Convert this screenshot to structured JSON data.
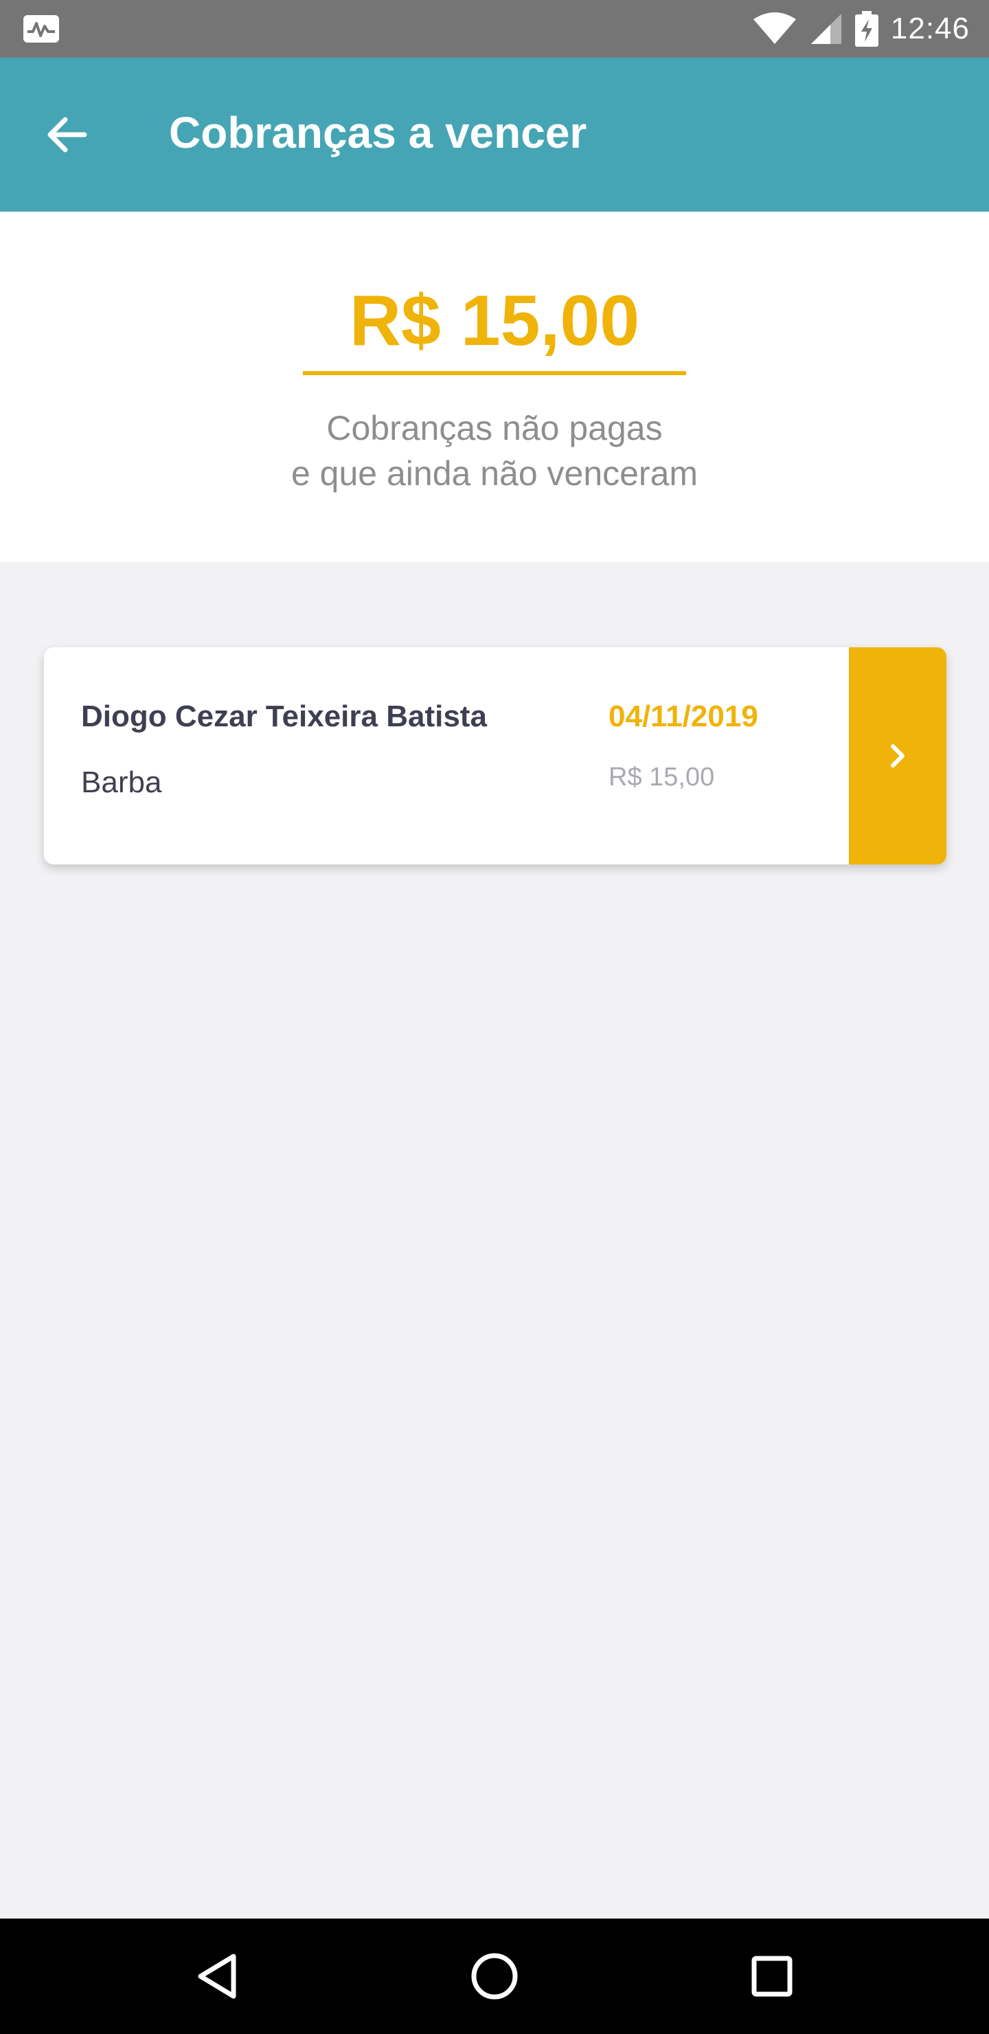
{
  "status_bar": {
    "time": "12:46",
    "icons": [
      "activity-icon",
      "wifi-icon",
      "signal-icon",
      "battery-charging-icon"
    ]
  },
  "app_bar": {
    "title": "Cobranças a vencer",
    "back_icon": "arrow-left-icon"
  },
  "summary": {
    "amount": "R$ 15,00",
    "description_line1": "Cobranças não pagas",
    "description_line2": "e que ainda não venceram"
  },
  "charges": [
    {
      "client_name": "Diogo Cezar Teixeira Batista",
      "service": "Barba",
      "due_date": "04/11/2019",
      "amount": "R$ 15,00",
      "action_icon": "chevron-right-icon"
    }
  ],
  "nav_bar": {
    "icons": [
      "back-triangle-icon",
      "home-circle-icon",
      "recents-square-icon"
    ]
  },
  "colors": {
    "status_bar": "#757575",
    "app_bar": "#45a5b4",
    "accent": "#efb30a",
    "text_dark": "#3f3f52",
    "text_muted": "#8e8e8e",
    "background": "#f2f2f4"
  }
}
